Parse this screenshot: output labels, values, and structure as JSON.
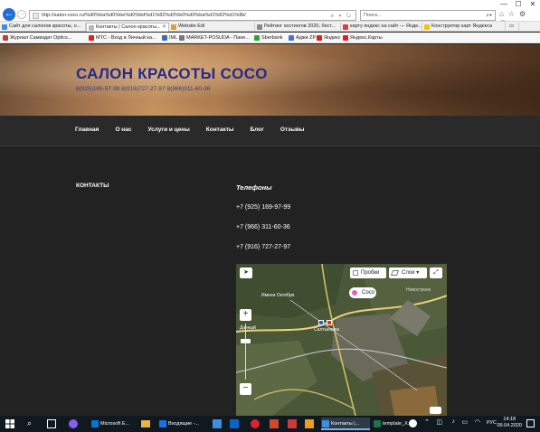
{
  "browser": {
    "url": "http://salon-coco.ru/%d0%ba%d0%be%d0%bd%d1%82%d0%b0%d0%ba%d1%82%d1%8b/",
    "search_placeholder": "Поиск...",
    "tabs": [
      {
        "label": "Сайт для салонов красоты, н...",
        "color": "#3d8ee0"
      },
      {
        "label": "Контакты | Салон красоты...",
        "color": "#b5b5b5",
        "active": true
      },
      {
        "label": "Website Edi",
        "color": "#e0a030"
      },
      {
        "label": "Рейтинг хостингов 2020, бест...",
        "color": "#888"
      },
      {
        "label": "карту яндекс на сайт — Яндe...",
        "color": "#e23b3b"
      },
      {
        "label": "Конструктор карт Яндекса",
        "color": "#f5c400"
      }
    ],
    "favorites": [
      {
        "label": "Журнал Самиздат Optics...",
        "color": "#c43a3a"
      },
      {
        "label": "МТС - Вход в Личный ка...",
        "color": "#e02020"
      },
      {
        "label": "IML",
        "color": "#3a6ab0"
      },
      {
        "label": "MARKET-POSUDA - Пане...",
        "color": "#777"
      },
      {
        "label": "Sberbank",
        "color": "#2fa32f"
      },
      {
        "label": "Аджи ZP",
        "color": "#4a6fd0"
      },
      {
        "label": "Яндекс",
        "color": "#e02020"
      },
      {
        "label": "Яндекс.Карты",
        "color": "#e02020"
      }
    ]
  },
  "site": {
    "title": "САЛОН КРАСОТЫ COCO",
    "phones_line": "8(925)169-97-99 8(916)727-27-97 8(966)311-60-36",
    "menu": [
      "Главная",
      "О нас",
      "Услуги и цены",
      "Контакты",
      "Блог",
      "Отзывы"
    ],
    "section_title": "КОНТАКТЫ",
    "phones_heading": "Телефоны",
    "phones": [
      "+7 (925) 169-97-99",
      "+7 (966) 311-60-36",
      "+7 (916) 727-27-97"
    ]
  },
  "map": {
    "traffic_label": "Пробки",
    "layers_label": "Слои",
    "marker_label": "Coco",
    "place_labels": [
      "Имени Октября",
      "Дачный",
      "Салтыковка",
      "Новостроек"
    ],
    "zoom_in": "+",
    "zoom_out": "−"
  },
  "taskbar": {
    "items": [
      {
        "label": "Microsoft E...",
        "color": "#0078d7"
      },
      {
        "label": "Входящие -...",
        "color": "#1a73e8"
      },
      {
        "label": "Контакты |...",
        "color": "#3d8ee0",
        "active": true
      },
      {
        "label": "template_X...",
        "color": "#217346"
      }
    ],
    "lang": "РУС",
    "time": "14:18",
    "date": "09.04.2020"
  }
}
